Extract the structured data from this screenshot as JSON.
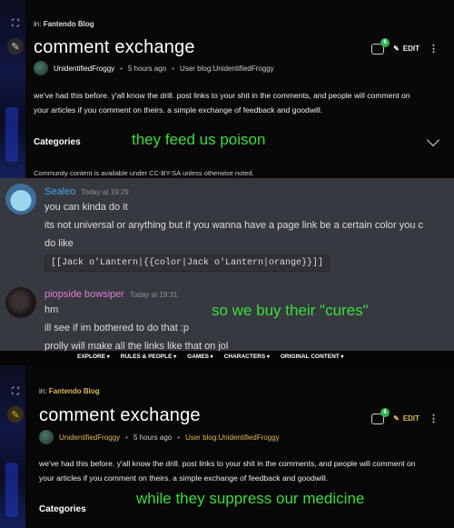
{
  "top": {
    "breadcrumb_prefix": "in:",
    "breadcrumb_link": "Fantendo Blog",
    "title": "comment exchange",
    "comment_count": "6",
    "edit_label": "EDIT",
    "author": "UnidentifiedFroggy",
    "time": "5 hours ago",
    "user_blog": "User blog:UnidentifiedFroggy",
    "body_1": "we've had this before. y'all know the drill. post links to your shit in the comments, and people will comment on",
    "body_2": "your articles if you comment on theirs. a simple exchange of feedback and goodwill.",
    "categories_label": "Categories",
    "license": "Community content is available under CC-BY-SA unless otherwise noted."
  },
  "captions": {
    "c1": "they feed us poison",
    "c2": "so we buy their \"cures\"",
    "c3": "while they suppress our medicine"
  },
  "chat": {
    "messages": [
      {
        "author": "Sealeo",
        "time": "Today at 19:29",
        "lines": [
          "you can kinda do it",
          "its not universal or anything but if you wanna have a page link be a certain color you c",
          "do like"
        ],
        "code": "[[Jack o'Lantern|{{color|Jack o'Lantern|orange}}]]"
      },
      {
        "author": "piopside bowsiper",
        "time": "Today at 19:31",
        "lines": [
          "hm",
          "ill see if im bothered to do that :p",
          "prolly will make all the links like that on jol"
        ]
      }
    ]
  },
  "nav": {
    "items": [
      "EXPLORE",
      "RULES & PEOPLE",
      "GAMES",
      "CHARACTERS",
      "ORIGINAL CONTENT"
    ]
  },
  "bottom": {
    "breadcrumb_prefix": "in:",
    "breadcrumb_link": "Fantendo Blog",
    "title": "comment exchange",
    "comment_count": "6",
    "edit_label": "EDIT",
    "author": "UnidentifiedFroggy",
    "time": "5 hours ago",
    "user_blog": "User blog:UnidentifiedFroggy",
    "body_1": "we've had this before. y'all know the drill. post links to your shit in the comments, and people will comment on",
    "body_2": "your articles if you comment on theirs. a simple exchange of feedback and goodwill.",
    "categories_label": "Categories"
  },
  "colors": {
    "caption_green": "#3ddc3d",
    "gold_link": "#e0b75a",
    "badge_green": "#2fb34a",
    "chat_bg": "#36393f"
  },
  "icons": [
    "expand-icon",
    "pencil-icon",
    "comment-icon",
    "edit-icon",
    "kebab-icon",
    "chevron-down-icon"
  ]
}
